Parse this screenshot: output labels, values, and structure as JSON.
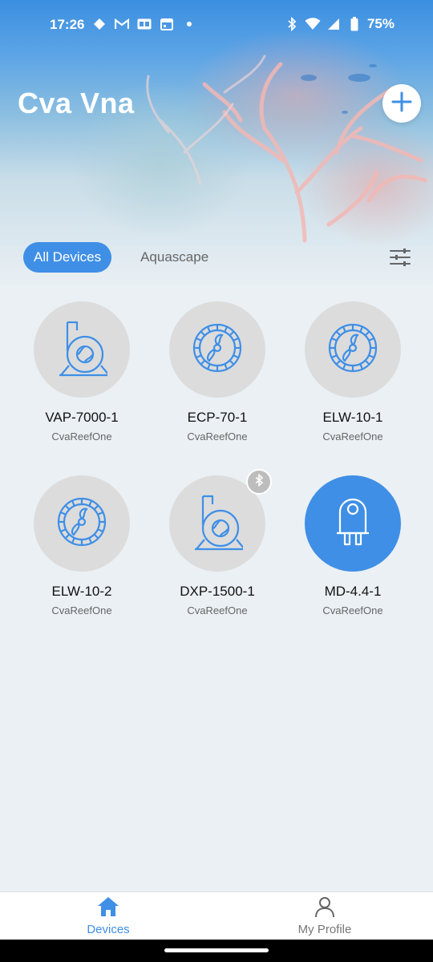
{
  "status_bar": {
    "time": "17:26",
    "battery": "75%",
    "left_icons": [
      "diamond-icon",
      "gmail-icon",
      "ge-icon",
      "calendar-icon",
      "dot-icon"
    ],
    "right_icons": [
      "bluetooth-icon",
      "wifi-icon",
      "signal-icon",
      "battery-icon"
    ]
  },
  "header": {
    "title": "Cva Vna",
    "add_icon": "plus-icon"
  },
  "tabs": [
    {
      "label": "All Devices",
      "active": true
    },
    {
      "label": "Aquascape",
      "active": false
    }
  ],
  "filter_icon": "sliders-icon",
  "devices": [
    {
      "name": "VAP-7000-1",
      "sub": "CvaReefOne",
      "icon": "centrifugal-pump-icon",
      "active": false,
      "bluetooth": false
    },
    {
      "name": "ECP-70-1",
      "sub": "CvaReefOne",
      "icon": "wave-pump-icon",
      "active": false,
      "bluetooth": false
    },
    {
      "name": "ELW-10-1",
      "sub": "CvaReefOne",
      "icon": "wave-pump-icon",
      "active": false,
      "bluetooth": false
    },
    {
      "name": "ELW-10-2",
      "sub": "CvaReefOne",
      "icon": "wave-pump-icon",
      "active": false,
      "bluetooth": false
    },
    {
      "name": "DXP-1500-1",
      "sub": "CvaReefOne",
      "icon": "centrifugal-pump-icon",
      "active": false,
      "bluetooth": true
    },
    {
      "name": "MD-4.4-1",
      "sub": "CvaReefOne",
      "icon": "dosing-pump-icon",
      "active": true,
      "bluetooth": false
    }
  ],
  "bottom_nav": [
    {
      "label": "Devices",
      "icon": "home-icon",
      "active": true
    },
    {
      "label": "My Profile",
      "icon": "person-icon",
      "active": false
    }
  ],
  "colors": {
    "accent": "#3f8fe6",
    "device_circle": "#dcdcdc",
    "background": "#eaf0f4"
  }
}
